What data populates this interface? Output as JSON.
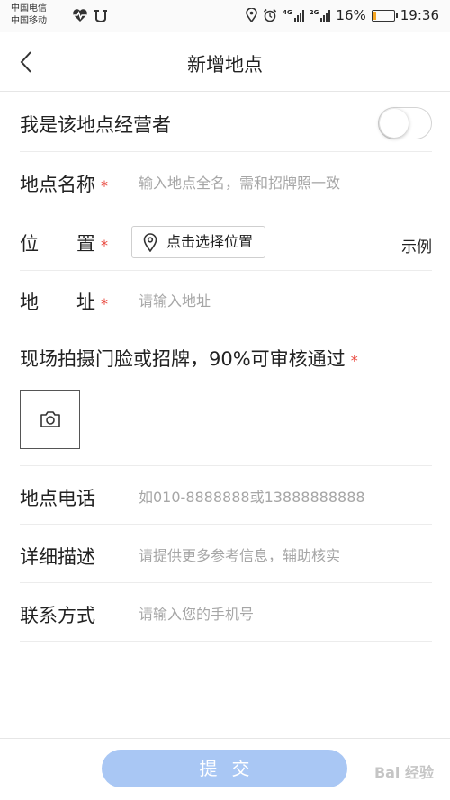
{
  "status_bar": {
    "carrier_1": "中国电信",
    "carrier_2": "中国移动",
    "net_1": "4G",
    "net_2": "2G",
    "battery_pct": "16%",
    "battery_level": 0.16,
    "time": "19:36"
  },
  "nav": {
    "title": "新增地点",
    "back_icon": "chevron-left-icon"
  },
  "form": {
    "operator": {
      "label": "我是该地点经营者",
      "toggle_on": false
    },
    "name": {
      "label": "地点名称",
      "required": "*",
      "placeholder": "输入地点全名，需和招牌照一致"
    },
    "position": {
      "label": "位　　置",
      "required": "*",
      "button": "点击选择位置",
      "example": "示例"
    },
    "address": {
      "label": "地　　址",
      "required": "*",
      "placeholder": "请输入地址"
    },
    "photo": {
      "label": "现场拍摄门脸或招牌，90%可审核通过",
      "required": "*",
      "icon": "camera-icon"
    },
    "phone": {
      "label": "地点电话",
      "placeholder": "如010-8888888或13888888888"
    },
    "description": {
      "label": "详细描述",
      "placeholder": "请提供更多参考信息，辅助核实"
    },
    "contact": {
      "label": "联系方式",
      "placeholder": "请输入您的手机号"
    }
  },
  "footer": {
    "submit_label": "提交",
    "watermark": "Bai 经验"
  },
  "colors": {
    "required": "#e8443a",
    "submit_bg": "#a9c7f4",
    "placeholder": "#a6a6a6"
  }
}
